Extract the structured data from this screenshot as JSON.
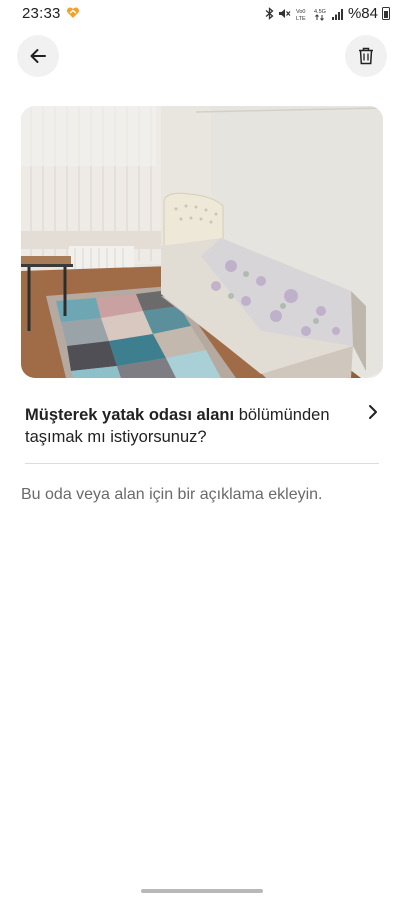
{
  "status_bar": {
    "time": "23:33",
    "app_icon": "heart-notification-icon",
    "signal_text_top": "Vo0 4.5G",
    "battery": "%84",
    "icons": [
      "bluetooth-icon",
      "mute-icon",
      "volte-icon",
      "network-4.5g-icon",
      "signal-icon",
      "battery-icon"
    ]
  },
  "header": {
    "back_icon": "arrow-left-icon",
    "delete_icon": "trash-icon"
  },
  "photo": {
    "subject": "bedroom-photo"
  },
  "move_prompt": {
    "bold": "Müşterek yatak odası alanı",
    "rest": " bölümünden taşımak mı istiyorsunuz?"
  },
  "description": {
    "placeholder": "Bu oda veya alan için bir açıklama ekleyin."
  },
  "colors": {
    "background": "#ffffff",
    "button_bg": "#f1f1f1",
    "text": "#222222",
    "muted_text": "#6a6a6a",
    "divider": "#dddddd"
  }
}
